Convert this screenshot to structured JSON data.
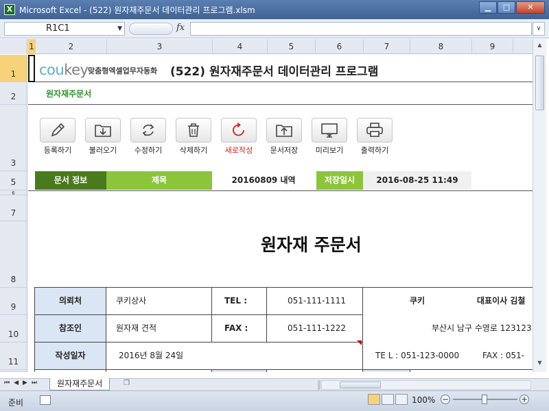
{
  "window": {
    "title": "Microsoft Excel - (522) 원자재주문서 데이터관리 프로그램.xlsm",
    "app_icon": "X"
  },
  "formula_bar": {
    "name_box": "R1C1",
    "fx": "fx",
    "content": ""
  },
  "columns": [
    "1",
    "2",
    "3",
    "4",
    "5",
    "6",
    "7",
    "8",
    "9"
  ],
  "rows": [
    "1",
    "2",
    "3",
    "5",
    "6",
    "7",
    "8",
    "9",
    "10",
    "11"
  ],
  "sheet": {
    "logo": {
      "cou": "cou",
      "key": "key"
    },
    "logo_subtitle": "맞춤형엑셀업무자동화",
    "main_title": "(522) 원자재주문서 데이터관리 프로그램",
    "subheader": "원자재주문서",
    "toolbar": [
      {
        "label": "등록하기",
        "icon": "pencil-icon"
      },
      {
        "label": "불러오기",
        "icon": "folder-download-icon"
      },
      {
        "label": "수정하기",
        "icon": "refresh-icon"
      },
      {
        "label": "삭제하기",
        "icon": "trash-icon"
      },
      {
        "label": "새로작성",
        "icon": "new-document-icon"
      },
      {
        "label": "문서저장",
        "icon": "folder-upload-icon"
      },
      {
        "label": "미리보기",
        "icon": "monitor-icon"
      },
      {
        "label": "출력하기",
        "icon": "printer-icon"
      }
    ],
    "info": {
      "doc_info_label": "문서 정보",
      "title_label": "제목",
      "title_value": "20160809 내역",
      "saved_label": "저장일시",
      "saved_value": "2016-08-25 11:49"
    },
    "document_title": "원자재 주문서",
    "form": {
      "client_label": "의뢰처",
      "client_value": "쿠키상사",
      "tel_label": "TEL :",
      "tel_value": "051-111-1111",
      "ref_label": "참조인",
      "ref_value": "원자재 견적",
      "fax_label": "FAX :",
      "fax_value": "051-111-1222",
      "date_label": "작성일자",
      "date_value": "2016년 8월 24일",
      "company_name": "쿠키",
      "ceo_label": "대표이사  김철",
      "address": "부산시 남구 수영로 123123",
      "company_tel": "TE L :    051-123-0000",
      "company_fax": "FAX :    051-"
    }
  },
  "tabs": {
    "sheet_name": "원자재주문서"
  },
  "status": {
    "ready": "준비",
    "zoom": "100%"
  },
  "colors": {
    "dark_green": "#4b7a1e",
    "light_green": "#8cc43c",
    "label_blue": "#dbe6f4",
    "selected_header": "#f7d27a"
  }
}
